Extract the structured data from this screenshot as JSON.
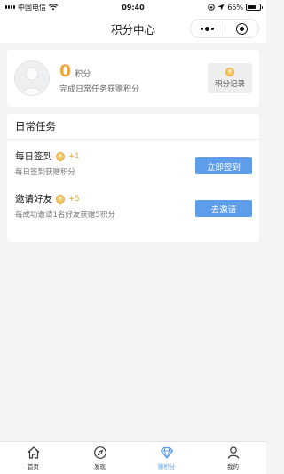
{
  "status_bar": {
    "carrier": "中国电信",
    "time": "09:40",
    "battery": "66%",
    "battery_level": 0.66
  },
  "nav": {
    "title": "积分中心"
  },
  "points_card": {
    "value": "0",
    "unit": "积分",
    "description": "完成日常任务获赠积分",
    "records_label": "积分记录"
  },
  "tasks": {
    "title": "日常任务",
    "items": [
      {
        "name": "每日签到",
        "reward": "+1",
        "description": "每日签到获赠积分",
        "button": "立即签到"
      },
      {
        "name": "邀请好友",
        "reward": "+5",
        "description": "每成功邀请1名好友获赠5积分",
        "button": "去邀请"
      }
    ]
  },
  "tab_bar": {
    "items": [
      {
        "label": "首页",
        "icon": "home-icon"
      },
      {
        "label": "发现",
        "icon": "compass-icon"
      },
      {
        "label": "赚积分",
        "icon": "diamond-icon",
        "active": true
      },
      {
        "label": "我的",
        "icon": "user-icon"
      }
    ]
  },
  "colors": {
    "accent": "#5e9dea",
    "points": "#f1a63b",
    "background": "#f4f4f5"
  }
}
